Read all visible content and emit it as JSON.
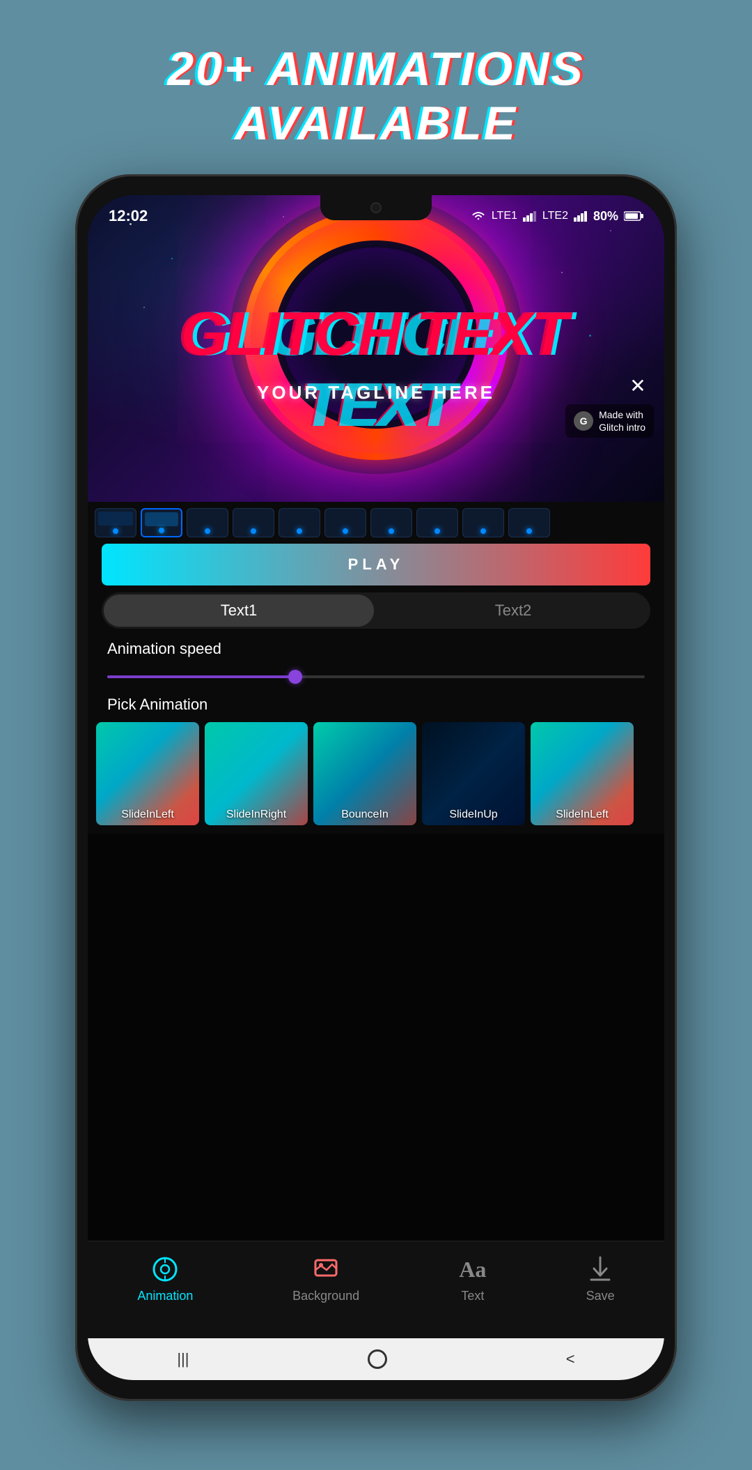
{
  "header": {
    "title": "20+ ANIMATIONS AVAILABLE"
  },
  "status_bar": {
    "time": "12:02",
    "battery": "80%",
    "icons": "wifi signal lte"
  },
  "preview": {
    "main_text": "GLITCH TEXT",
    "tagline": "YOUR TAGLINE HERE",
    "made_with": "Made with\nGlitch intro",
    "close_label": "×"
  },
  "play_button": {
    "label": "PLAY"
  },
  "tabs": {
    "tab1": "Text1",
    "tab2": "Text2"
  },
  "animation_speed": {
    "label": "Animation speed",
    "value": 35
  },
  "pick_animation": {
    "label": "Pick Animation",
    "cards": [
      {
        "name": "SlideInLeft",
        "style": "gradient1"
      },
      {
        "name": "SlideInRight",
        "style": "gradient2"
      },
      {
        "name": "BounceIn",
        "style": "gradient3"
      },
      {
        "name": "SlideInUp",
        "style": "dark"
      },
      {
        "name": "SlideInLeft",
        "style": "gradient1"
      }
    ]
  },
  "bottom_nav": {
    "items": [
      {
        "id": "animation",
        "label": "Animation",
        "active": true
      },
      {
        "id": "background",
        "label": "Background",
        "active": false
      },
      {
        "id": "text",
        "label": "Text",
        "active": false
      },
      {
        "id": "save",
        "label": "Save",
        "active": false
      }
    ]
  },
  "home_bar": {
    "back": "<",
    "home": "○",
    "recent": "|||"
  }
}
